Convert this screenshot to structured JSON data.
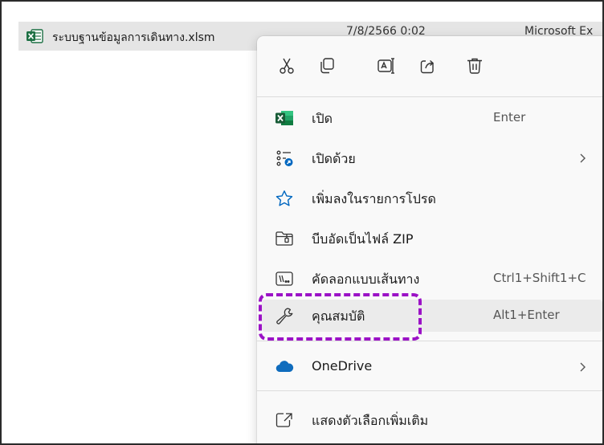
{
  "file": {
    "name": "ระบบฐานข้อมูลการเดินทาง.xlsm",
    "date": "7/8/2566 0:02",
    "type": "Microsoft Ex"
  },
  "quick_actions": [
    {
      "name": "cut",
      "icon": "scissors-icon"
    },
    {
      "name": "copy",
      "icon": "copy-icon"
    },
    {
      "name": "rename",
      "icon": "rename-icon"
    },
    {
      "name": "share",
      "icon": "share-icon"
    },
    {
      "name": "delete",
      "icon": "trash-icon"
    }
  ],
  "menu": {
    "open": {
      "label": "เปิด",
      "shortcut": "Enter",
      "icon": "excel-icon"
    },
    "open_with": {
      "label": "เปิดด้วย",
      "icon": "open-with-icon"
    },
    "add_favorites": {
      "label": "เพิ่มลงในรายการโปรด",
      "icon": "star-icon"
    },
    "compress_zip": {
      "label": "บีบอัดเป็นไฟล์ ZIP",
      "icon": "zip-folder-icon"
    },
    "copy_path": {
      "label": "คัดลอกแบบเส้นทาง",
      "shortcut": "Ctrl1+Shift1+C",
      "icon": "path-icon"
    },
    "properties": {
      "label": "คุณสมบัติ",
      "shortcut": "Alt1+Enter",
      "icon": "wrench-icon"
    },
    "onedrive": {
      "label": "OneDrive",
      "icon": "cloud-icon"
    },
    "show_more": {
      "label": "แสดงตัวเลือกเพิ่มเติม",
      "icon": "expand-icon"
    }
  },
  "colors": {
    "highlight": "#9b12c6",
    "excel_green": "#1d7044",
    "onedrive_blue": "#0f6cbd",
    "accent_blue": "#0067c0"
  }
}
